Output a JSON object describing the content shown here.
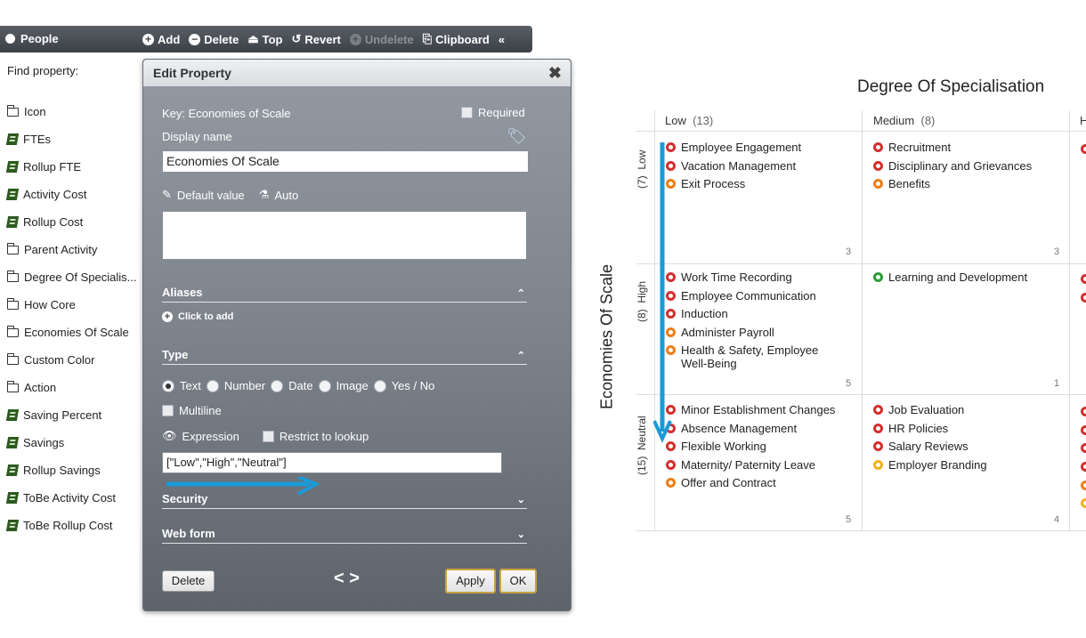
{
  "toolbar": {
    "people_label": "People",
    "add": "Add",
    "delete": "Delete",
    "top": "Top",
    "revert": "Revert",
    "undelete": "Undelete",
    "clipboard": "Clipboard",
    "collapse": "«"
  },
  "sidebar": {
    "find_label": "Find property:",
    "items": [
      {
        "label": "Icon",
        "icon": "folder-icon"
      },
      {
        "label": "FTEs",
        "icon": "calculator-icon"
      },
      {
        "label": "Rollup FTE",
        "icon": "calculator-icon"
      },
      {
        "label": "Activity Cost",
        "icon": "calculator-icon"
      },
      {
        "label": "Rollup Cost",
        "icon": "calculator-icon"
      },
      {
        "label": "Parent Activity",
        "icon": "folder-icon"
      },
      {
        "label": "Degree Of Specialis...",
        "icon": "folder-icon"
      },
      {
        "label": "How Core",
        "icon": "folder-icon"
      },
      {
        "label": "Economies Of Scale",
        "icon": "folder-icon"
      },
      {
        "label": "Custom Color",
        "icon": "folder-icon"
      },
      {
        "label": "Action",
        "icon": "folder-icon"
      },
      {
        "label": "Saving Percent",
        "icon": "calculator-icon"
      },
      {
        "label": "Savings",
        "icon": "calculator-icon"
      },
      {
        "label": "Rollup Savings",
        "icon": "calculator-icon"
      },
      {
        "label": "ToBe Activity Cost",
        "icon": "calculator-icon"
      },
      {
        "label": "ToBe Rollup Cost",
        "icon": "calculator-icon"
      }
    ]
  },
  "dialog": {
    "title": "Edit Property",
    "close": "✖",
    "key_text": "Key: Economies of Scale",
    "required_label": "Required",
    "display_name_label": "Display name",
    "display_name_value": "Economies Of Scale",
    "default_value_label": "Default value",
    "auto_label": "Auto",
    "aliases_label": "Aliases",
    "click_to_add": "Click to add",
    "type_label": "Type",
    "type_options": [
      "Text",
      "Number",
      "Date",
      "Image",
      "Yes / No"
    ],
    "type_selected": "Text",
    "multiline_label": "Multiline",
    "expression_label": "Expression",
    "restrict_label": "Restrict to lookup",
    "expression_value": "[\"Low\",\"High\",\"Neutral\"]",
    "security_label": "Security",
    "webform_label": "Web form",
    "delete_btn": "Delete",
    "apply_btn": "Apply",
    "ok_btn": "OK",
    "nav_symbols": "< >"
  },
  "matrix": {
    "title": "Degree Of Specialisation",
    "y_axis": "Economies Of Scale",
    "columns": [
      {
        "name": "Low",
        "count": "(13)"
      },
      {
        "name": "Medium",
        "count": "(8)"
      },
      {
        "name": "H",
        "count": ""
      }
    ],
    "rows": [
      {
        "name": "Low",
        "count": "(7)"
      },
      {
        "name": "High",
        "count": "(8)"
      },
      {
        "name": "Neutral",
        "count": "(15)"
      }
    ],
    "cells": {
      "low_low": {
        "items": [
          {
            "text": "Employee Engagement",
            "color": "red"
          },
          {
            "text": "Vacation Management",
            "color": "red"
          },
          {
            "text": "Exit Process",
            "color": "orange"
          }
        ],
        "count": "3"
      },
      "low_med": {
        "items": [
          {
            "text": "Recruitment",
            "color": "red"
          },
          {
            "text": "Disciplinary and Grievances",
            "color": "red"
          },
          {
            "text": "Benefits",
            "color": "orange"
          }
        ],
        "count": "3"
      },
      "high_low": {
        "items": [
          {
            "text": "Work Time Recording",
            "color": "red"
          },
          {
            "text": "Employee Communication",
            "color": "red"
          },
          {
            "text": "Induction",
            "color": "red"
          },
          {
            "text": "Administer Payroll",
            "color": "orange"
          },
          {
            "text": "Health & Safety, Employee Well-Being",
            "color": "orange"
          }
        ],
        "count": "5"
      },
      "high_med": {
        "items": [
          {
            "text": "Learning and Development",
            "color": "green"
          }
        ],
        "count": "1"
      },
      "neutral_low": {
        "items": [
          {
            "text": "Minor Establishment Changes",
            "color": "red"
          },
          {
            "text": "Absence Management",
            "color": "red"
          },
          {
            "text": "Flexible Working",
            "color": "red"
          },
          {
            "text": "Maternity/ Paternity Leave",
            "color": "red"
          },
          {
            "text": "Offer and Contract",
            "color": "orange"
          }
        ],
        "count": "5"
      },
      "neutral_med": {
        "items": [
          {
            "text": "Job Evaluation",
            "color": "red"
          },
          {
            "text": "HR Policies",
            "color": "red"
          },
          {
            "text": "Salary Reviews",
            "color": "red"
          },
          {
            "text": "Employer Branding",
            "color": "yellow"
          }
        ],
        "count": "4"
      }
    }
  },
  "colors": {
    "ring_red": "#d32f2f",
    "ring_orange": "#ef7d16",
    "ring_green": "#2e9a3a",
    "ring_yellow": "#f2b21d",
    "annotation_arrow": "#1a9ad6"
  }
}
